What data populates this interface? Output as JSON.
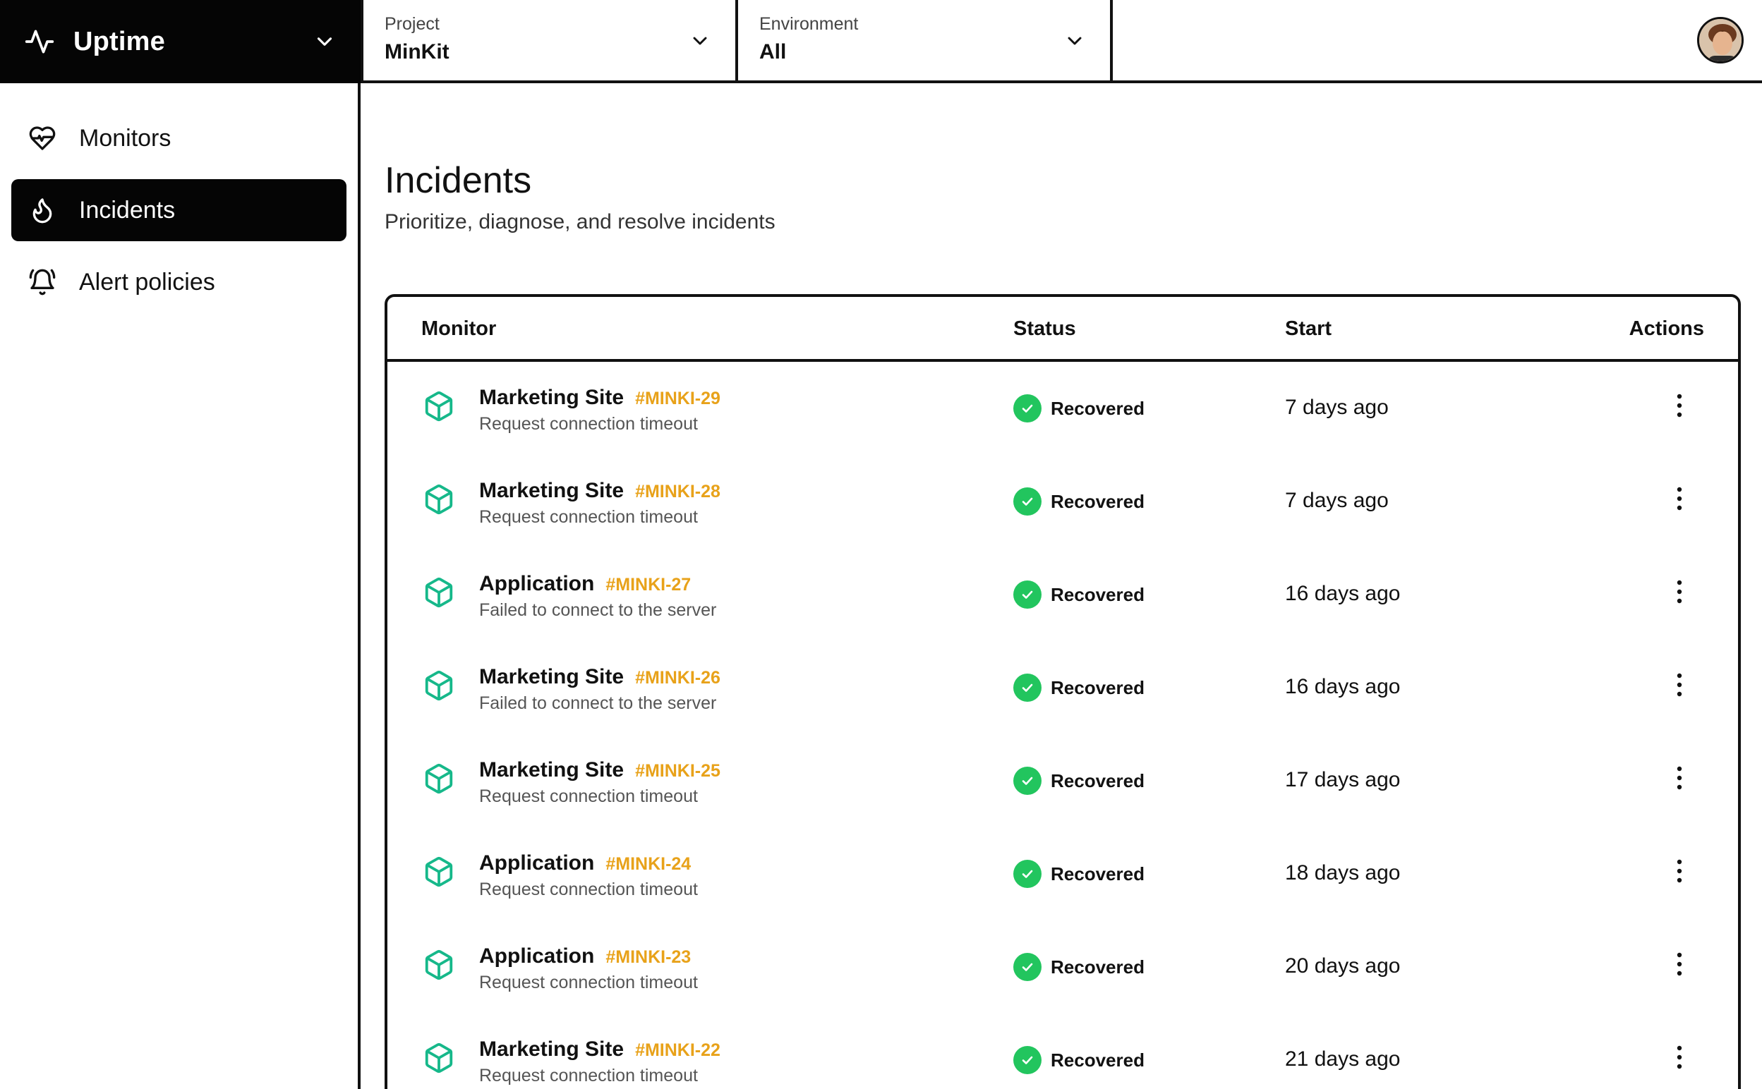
{
  "brand": {
    "title": "Uptime",
    "icon": "activity-icon"
  },
  "project": {
    "label": "Project",
    "value": "MinKit"
  },
  "environment": {
    "label": "Environment",
    "value": "All"
  },
  "sidebar": {
    "items": [
      {
        "label": "Monitors",
        "icon": "heart-pulse-icon",
        "active": false
      },
      {
        "label": "Incidents",
        "icon": "flame-icon",
        "active": true
      },
      {
        "label": "Alert policies",
        "icon": "bell-ring-icon",
        "active": false
      }
    ]
  },
  "page": {
    "title": "Incidents",
    "subtitle": "Prioritize, diagnose, and resolve incidents"
  },
  "table": {
    "columns": [
      "Monitor",
      "Status",
      "Start",
      "Actions"
    ],
    "rows": [
      {
        "name": "Marketing Site",
        "id": "#MINKI-29",
        "reason": "Request connection timeout",
        "status": "Recovered",
        "start": "7 days ago"
      },
      {
        "name": "Marketing Site",
        "id": "#MINKI-28",
        "reason": "Request connection timeout",
        "status": "Recovered",
        "start": "7 days ago"
      },
      {
        "name": "Application",
        "id": "#MINKI-27",
        "reason": "Failed to connect to the server",
        "status": "Recovered",
        "start": "16 days ago"
      },
      {
        "name": "Marketing Site",
        "id": "#MINKI-26",
        "reason": "Failed to connect to the server",
        "status": "Recovered",
        "start": "16 days ago"
      },
      {
        "name": "Marketing Site",
        "id": "#MINKI-25",
        "reason": "Request connection timeout",
        "status": "Recovered",
        "start": "17 days ago"
      },
      {
        "name": "Application",
        "id": "#MINKI-24",
        "reason": "Request connection timeout",
        "status": "Recovered",
        "start": "18 days ago"
      },
      {
        "name": "Application",
        "id": "#MINKI-23",
        "reason": "Request connection timeout",
        "status": "Recovered",
        "start": "20 days ago"
      },
      {
        "name": "Marketing Site",
        "id": "#MINKI-22",
        "reason": "Request connection timeout",
        "status": "Recovered",
        "start": "21 days ago"
      }
    ]
  },
  "colors": {
    "accent_id": "#E8A21A",
    "status_ok": "#22C55E",
    "monitor_icon": "#16B88A",
    "dark": "#050505"
  }
}
